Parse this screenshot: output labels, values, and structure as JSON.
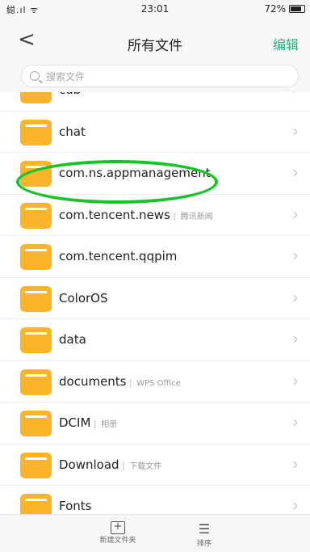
{
  "status": {
    "signal": "縂.ıl ᯤ",
    "time": "23:01",
    "battery": "72%",
    "battery_level": 0.72
  },
  "header": {
    "back": "<",
    "title": "所有文件",
    "edit": "编辑"
  },
  "search": {
    "placeholder": "搜索文件"
  },
  "files": [
    {
      "name": "cdb",
      "sub": ""
    },
    {
      "name": "chat",
      "sub": ""
    },
    {
      "name": "com.ns.appmanagement",
      "sub": ""
    },
    {
      "name": "com.tencent.news",
      "sub": "腾讯新闻"
    },
    {
      "name": "com.tencent.qqpim",
      "sub": ""
    },
    {
      "name": "ColorOS",
      "sub": ""
    },
    {
      "name": "data",
      "sub": ""
    },
    {
      "name": "documents",
      "sub": "WPS Office"
    },
    {
      "name": "DCIM",
      "sub": "相册"
    },
    {
      "name": "Download",
      "sub": "下载文件"
    },
    {
      "name": "Fonts",
      "sub": ""
    }
  ],
  "bottom": {
    "new_folder": "新建文件夹",
    "sort": "排序"
  },
  "colors": {
    "accent": "#2bab7e",
    "folder": "#fcb42a",
    "highlight": "#18c42a"
  }
}
